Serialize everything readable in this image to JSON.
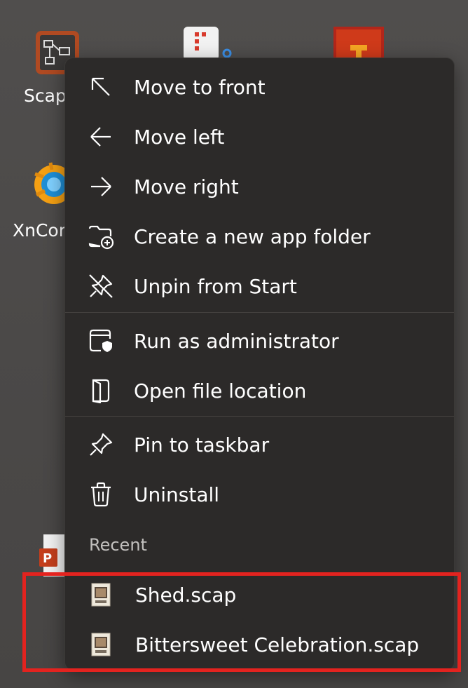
{
  "desktop": {
    "tiles": [
      {
        "name": "Scap",
        "label": "Scap"
      },
      {
        "name": "XnConvert",
        "label": "XnCor"
      },
      {
        "name": "PowerPoint",
        "label": ""
      }
    ]
  },
  "menu": {
    "items": [
      {
        "label": "Move to front",
        "icon": "arrow-up-left-icon"
      },
      {
        "label": "Move left",
        "icon": "arrow-left-icon"
      },
      {
        "label": "Move right",
        "icon": "arrow-right-icon"
      },
      {
        "label": "Create a new app folder",
        "icon": "folder-add-icon"
      },
      {
        "label": "Unpin from Start",
        "icon": "unpin-icon"
      },
      {
        "label": "Run as administrator",
        "icon": "shield-window-icon"
      },
      {
        "label": "Open file location",
        "icon": "open-file-icon"
      },
      {
        "label": "Pin to taskbar",
        "icon": "pin-icon"
      },
      {
        "label": "Uninstall",
        "icon": "trash-icon"
      }
    ],
    "recent_header": "Recent",
    "recent_items": [
      {
        "label": "Shed.scap",
        "icon": "scap-file-icon"
      },
      {
        "label": "Bittersweet Celebration.scap",
        "icon": "scap-file-icon"
      }
    ]
  },
  "colors": {
    "menu_bg": "#2c2a29",
    "highlight": "#e3231f",
    "text": "#ffffff"
  }
}
